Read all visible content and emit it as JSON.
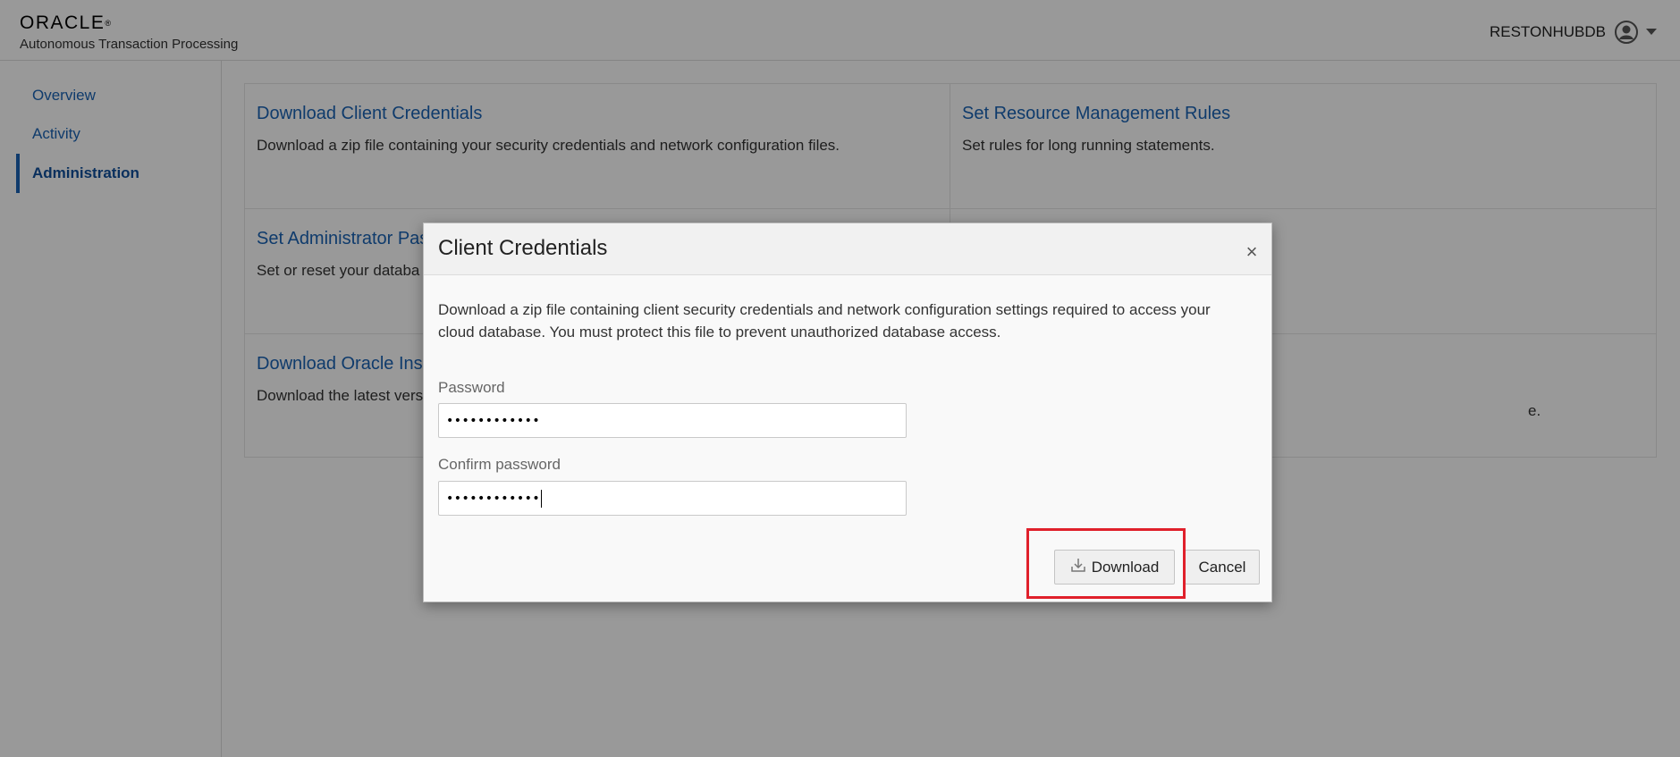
{
  "header": {
    "brand": "ORACLE",
    "brand_mark": "®",
    "product": "Autonomous Transaction Processing",
    "username": "RESTONHUBDB",
    "user_icon": "user-circle-icon",
    "menu_icon": "caret-down-icon"
  },
  "sidebar": {
    "items": [
      {
        "label": "Overview",
        "active": false
      },
      {
        "label": "Activity",
        "active": false
      },
      {
        "label": "Administration",
        "active": true
      }
    ]
  },
  "tiles": [
    {
      "title": "Download Client Credentials",
      "desc": "Download a zip file containing your security credentials and network configuration files."
    },
    {
      "title": "Set Resource Management Rules",
      "desc": "Set rules for long running statements."
    },
    {
      "title": "Set Administrator Pas",
      "desc": "Set or reset your databa"
    },
    {
      "title": "",
      "desc": ""
    },
    {
      "title": "Download Oracle Ins",
      "desc": "Download the latest vers"
    },
    {
      "title": "",
      "desc": "e."
    }
  ],
  "dialog": {
    "title": "Client Credentials",
    "close_icon": "close-icon",
    "description": "Download a zip file containing client security credentials and network configuration settings required to access your cloud database. You must protect this file to prevent unauthorized database access.",
    "password_label": "Password",
    "password_value": "••••••••••••",
    "confirm_label": "Confirm password",
    "confirm_value": "••••••••••••",
    "download_label": "Download",
    "download_icon": "download-icon",
    "cancel_label": "Cancel"
  },
  "colors": {
    "link": "#1a63b4",
    "highlight": "#e0202b"
  }
}
